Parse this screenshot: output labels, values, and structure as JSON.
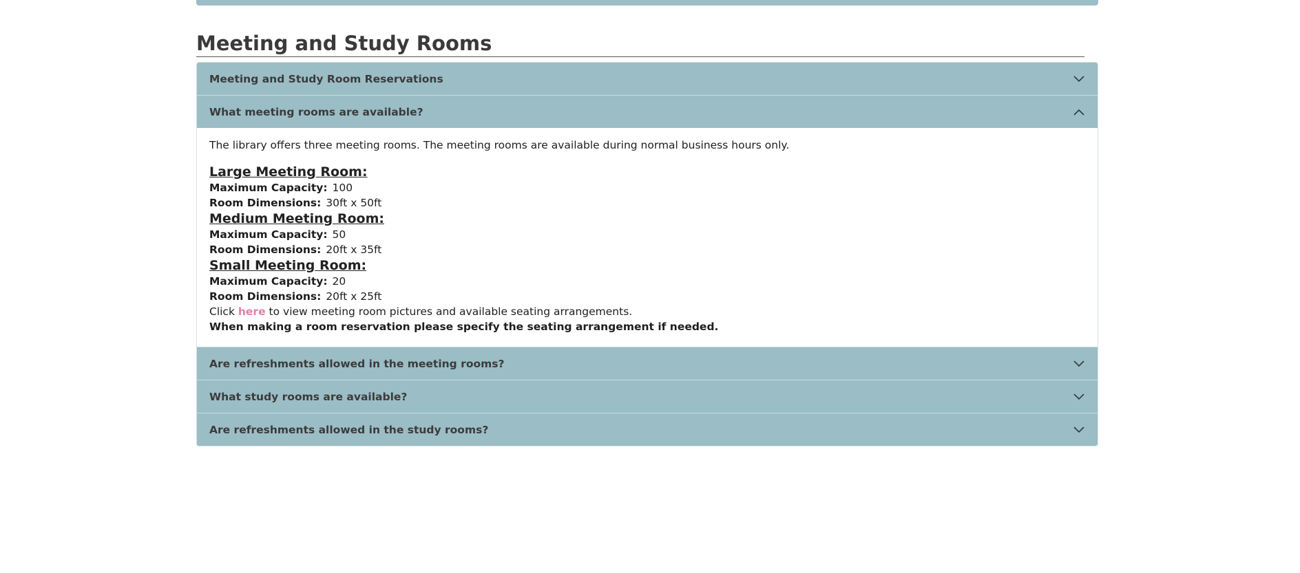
{
  "section_title": "Meeting and Study Rooms",
  "accordion": [
    {
      "title": "Meeting and Study Room Reservations",
      "expanded": false
    },
    {
      "title": "What meeting rooms are available?",
      "expanded": true
    },
    {
      "title": "Are refreshments allowed in the meeting rooms?",
      "expanded": false
    },
    {
      "title": "What study rooms are available?",
      "expanded": false
    },
    {
      "title": "Are refreshments allowed in the study rooms?",
      "expanded": false
    }
  ],
  "panel": {
    "intro": "The library offers three meeting rooms. The meeting rooms are available during normal business hours only.",
    "capacity_label": "Maximum Capacity:",
    "dimensions_label": "Room Dimensions:",
    "rooms": [
      {
        "name": "Large Meeting Room:",
        "capacity": "100",
        "dimensions": "30ft x 50ft"
      },
      {
        "name": "Medium Meeting Room:",
        "capacity": "50",
        "dimensions": "20ft x 35ft"
      },
      {
        "name": "Small Meeting Room:",
        "capacity": "20",
        "dimensions": "20ft x 25ft"
      }
    ],
    "click_prefix": "Click",
    "link_text": "here",
    "click_suffix": "to view meeting room pictures and available seating arrangements.",
    "note": "When making a room reservation please specify the seating arrangement if needed."
  },
  "colors": {
    "header_bg": "#9bbdc5",
    "link": "#e080a8"
  },
  "icons": {
    "collapsed": "chevron-down-icon",
    "expanded": "chevron-up-icon"
  }
}
